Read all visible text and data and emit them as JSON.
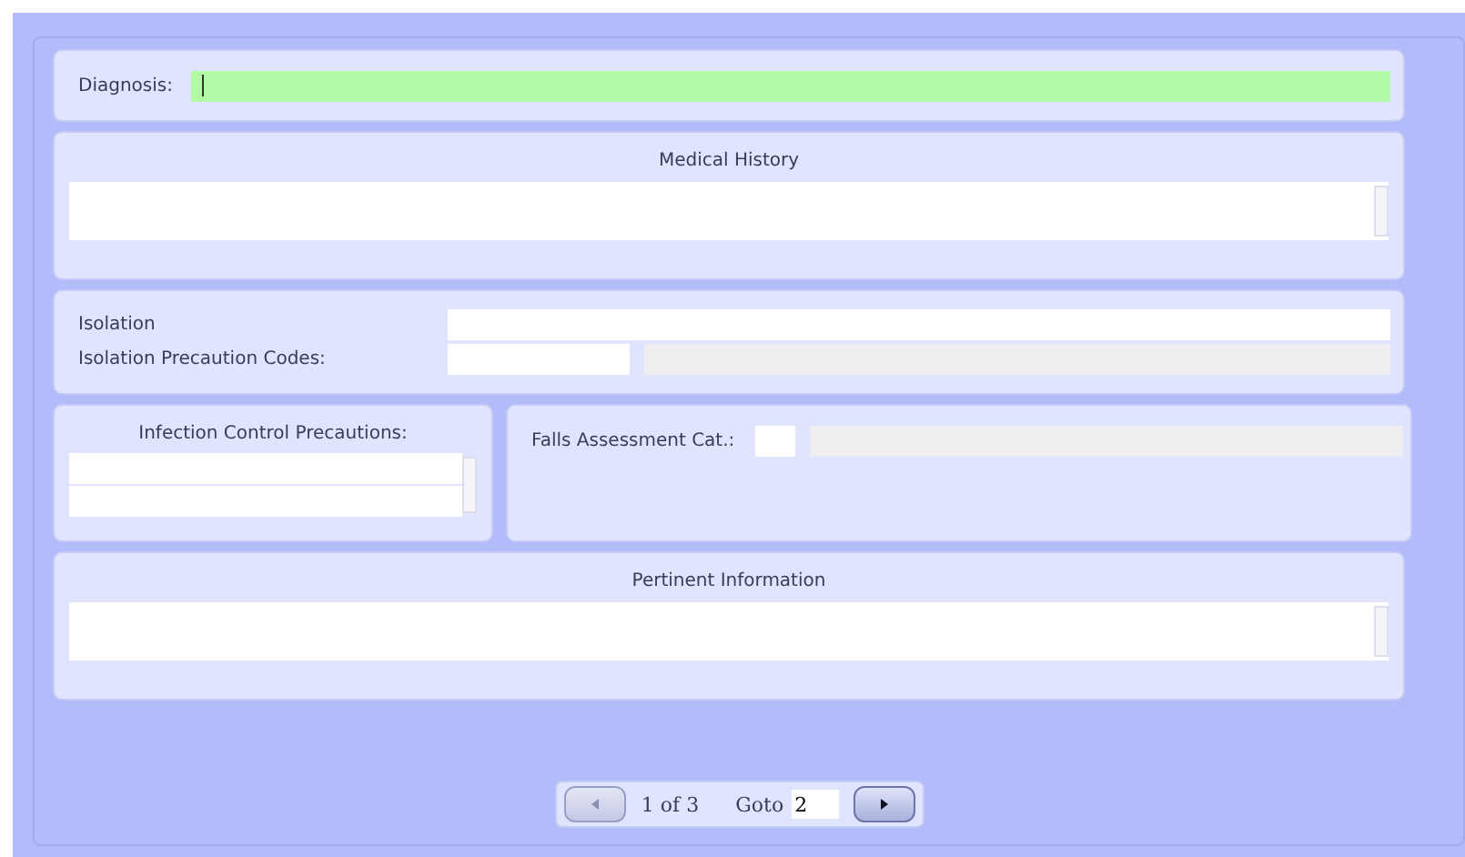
{
  "diagnosis": {
    "label": "Diagnosis:",
    "focused": true
  },
  "medical_history": {
    "title": "Medical History"
  },
  "isolation": {
    "label": "Isolation",
    "codes_label": "Isolation Precaution Codes:"
  },
  "infection_control": {
    "title": "Infection Control Precautions:"
  },
  "falls_assessment": {
    "label": "Falls Assessment Cat.:"
  },
  "pertinent_information": {
    "title": "Pertinent Information"
  },
  "pager": {
    "prev_disabled": true,
    "next_disabled": false,
    "position": "1 of 3",
    "goto_label": "Goto",
    "goto_value": "2"
  }
}
